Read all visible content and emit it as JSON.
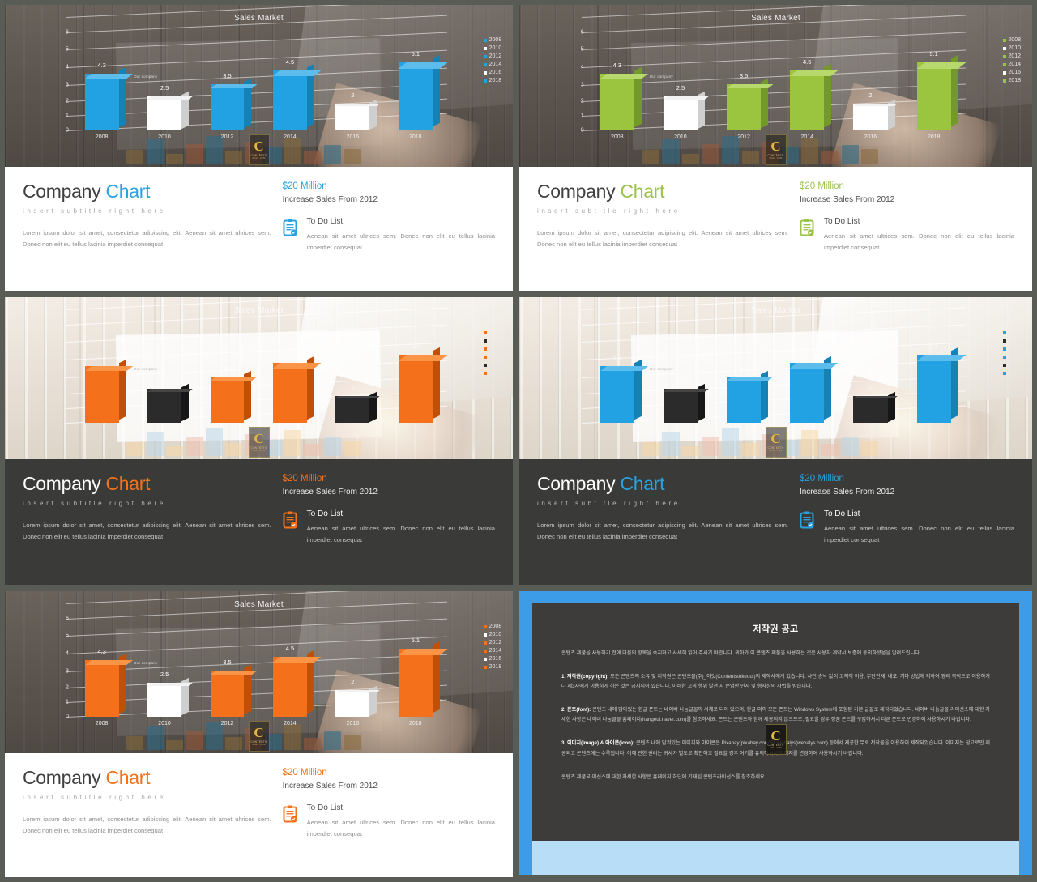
{
  "common": {
    "chart_title": "Sales Market",
    "company_title_main": "Company",
    "company_title_accent": "Chart",
    "subtitle": "insert subtitle right here",
    "body": "Lorem ipsum dolor sit amet, consectetur adipiscing elit. Aenean sit amet ultrices sem. Donec non elit eu tellus lacinia imperdiet consequat",
    "money": "$20 Million",
    "money_sub": "Increase Sales From 2012",
    "todo_title": "To Do List",
    "todo_body": "Aenean sit amet ultrices sem. Donec non elit eu tellus lacinia imperdiet consequat",
    "annotation_our_company": "Our company",
    "watermark_letter": "C",
    "watermark_line1": "CONTENTS",
    "watermark_line2": "MALL .COM"
  },
  "chart_data": {
    "type": "bar",
    "title": "Sales Market",
    "categories": [
      "2008",
      "2010",
      "2012",
      "2014",
      "2016",
      "2018"
    ],
    "values": [
      4.3,
      2.5,
      3.5,
      4.5,
      2,
      5.1
    ],
    "value_labels": [
      "4.3",
      "2.5",
      "3.5",
      "4.5",
      "2",
      "5.1"
    ],
    "yticks": [
      "0",
      "1",
      "2",
      "3",
      "4",
      "5",
      "6"
    ],
    "ylim": [
      0,
      7
    ],
    "xlabel": "",
    "ylabel": "",
    "grid": true,
    "legend_position": "right",
    "legend": [
      "2008",
      "2010",
      "2012",
      "2014",
      "2016",
      "2018"
    ],
    "highlight_indexes": [
      1,
      4
    ]
  },
  "panels": [
    {
      "id": "panel-blue-light",
      "accent": "#29a3e0",
      "bar_color": "#22a2e2",
      "bar_alt_color": "#ffffff",
      "chart_bg": "dark",
      "text_bg": "white",
      "legend_visible": true
    },
    {
      "id": "panel-green-light",
      "accent": "#9bc24a",
      "bar_color": "#9bc53f",
      "bar_alt_color": "#ffffff",
      "chart_bg": "dark",
      "text_bg": "white",
      "legend_visible": true
    },
    {
      "id": "panel-orange-dark",
      "accent": "#f4721b",
      "bar_color": "#f4701a",
      "bar_alt_color": "#2b2b2b",
      "chart_bg": "light",
      "text_bg": "dark",
      "legend_visible": true
    },
    {
      "id": "panel-blue-dark",
      "accent": "#29a3e0",
      "bar_color": "#22a2e2",
      "bar_alt_color": "#2b2b2b",
      "chart_bg": "light",
      "text_bg": "dark",
      "legend_visible": true
    },
    {
      "id": "panel-orange-light",
      "accent": "#f4721b",
      "bar_color": "#f4701a",
      "bar_alt_color": "#ffffff",
      "chart_bg": "dark",
      "text_bg": "white",
      "legend_visible": true
    }
  ],
  "copyright": {
    "title": "저작권 공고",
    "intro": "콘텐츠 제품을 사용하기 전에 다음의 항목을 숙지하고 사세히 읽어 주시기 바랍니다. 귀하가 이 콘텐츠 제품을 사용하는 것은 사용자 계약서 보증에 동의하셨음을 알려드립니다.",
    "p1_label": "1. 저작권(copyright):",
    "p1": "모든 콘텐츠의 소유 및 저작권은 콘텐츠몰(주)_이것(Contentstokeout)의 제작사에게 있습니다. 사전 승낙 없이 고의적 이용, 무단전재, 배포, 기타 방법에 의하여 영리 목적으로 이용하거나 제3자에게 이용하게 하는 것은 금지되어 있습니다. 이러한 고의 행위 발견 시 준엄한 민사 및 형사상의 사법을 받습니다.",
    "p2_label": "2. 폰트(font):",
    "p2": "콘텐츠 내에 담아있는 한글 폰트는 네이버 나눔글꼴의 서체로 되어 있으며, 한글 외의 모든 폰트는 Windows System에 포함된 기본 글꼴로 제작되었습니다. 네이버 나눔글꼴 라이선스에 대한 자세한 사항은 네이버 나눔글꼴 홈페이지(hangeul.naver.com)를 참조하세요. 폰트는 콘텐츠와 함께 제공되지 않으므로, 필요할 경우 정품 폰트를 구입하셔서 다른 폰트로 변경하여 사용하시기 바랍니다.",
    "p3_label": "3. 이미지(image) & 아이콘(icon):",
    "p3": "콘텐츠 내에 담겨있는 이미지와 아이콘은 Pixabay(pixabay.com)와 Webalys(webalys.com) 등에서 제공한 무료 저작물을 이용하여 제작되었습니다. 이미지는 참고로만 제공되고 콘텐츠에는 수록됩니다. 이에 관한 권리는 귀사가 별도로 확인하고 필요할 경우 여기를 유의하셔서 이미지를 변경하여 사용하시기 바랍니다.",
    "footer": "콘텐츠 제품 라이선스에 대한 자세한 사항은 홈페이지 하단에 기재된 콘텐츠라이선스를 참조하세요.",
    "watermark_letter": "C",
    "watermark_line1": "CONTENTS",
    "watermark_line2": "MALL .COM"
  }
}
